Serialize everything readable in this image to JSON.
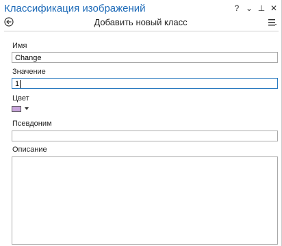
{
  "window": {
    "title": "Классификация изображений",
    "controls": {
      "help": "?",
      "dropdown": "⌄",
      "pin": "⊥",
      "close": "✕"
    }
  },
  "header": {
    "title": "Добавить новый класс",
    "back_icon": "back-arrow-circle-icon",
    "menu_icon": "hamburger-menu-icon"
  },
  "form": {
    "name": {
      "label": "Имя",
      "value": "Change"
    },
    "value": {
      "label": "Значение",
      "value": "1"
    },
    "color": {
      "label": "Цвет",
      "swatch": "#c9a6dc"
    },
    "alias": {
      "label": "Псевдоним",
      "value": ""
    },
    "description": {
      "label": "Описание",
      "value": ""
    }
  },
  "colors": {
    "title": "#1e6bb8",
    "focus_border": "#2a7ac0",
    "border": "#a9a9a9"
  }
}
